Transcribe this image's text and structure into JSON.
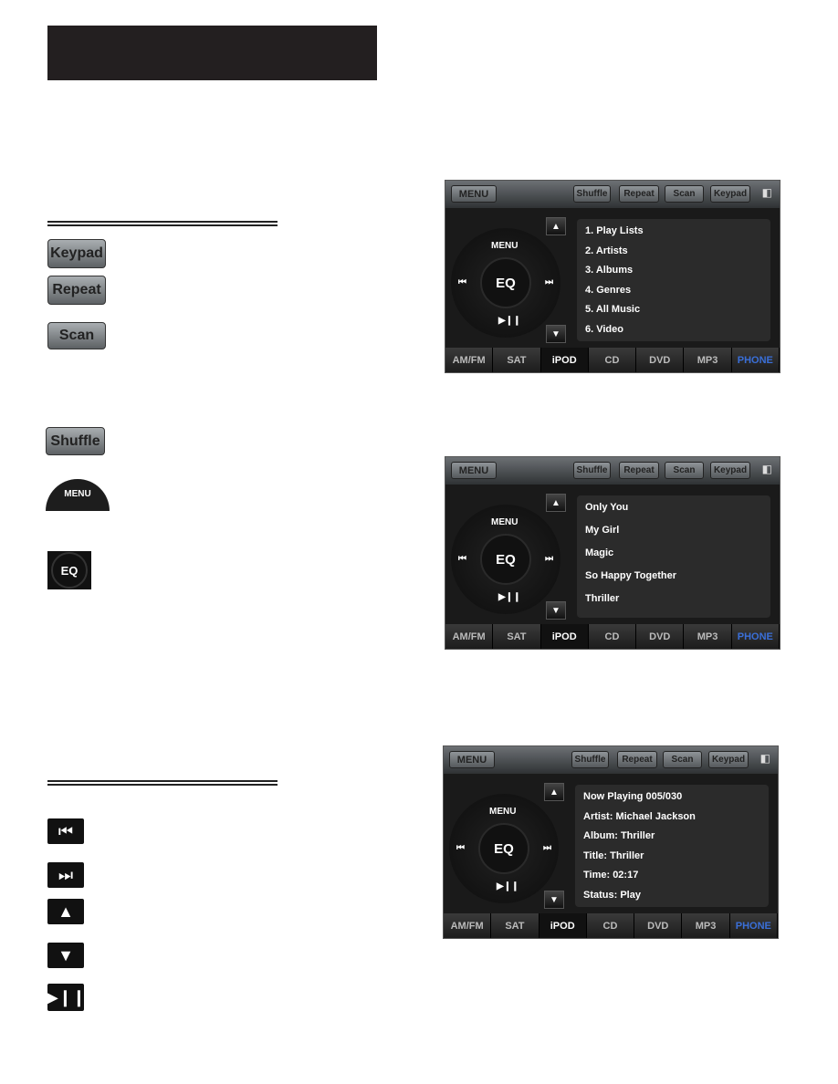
{
  "legend_buttons": {
    "keypad": "Keypad",
    "repeat": "Repeat",
    "scan": "Scan",
    "shuffle": "Shuffle",
    "menu": "MENU",
    "eq": "EQ"
  },
  "transport_icons": [
    "skip-back-icon",
    "skip-forward-icon",
    "arrow-up-icon",
    "arrow-down-icon",
    "play-pause-icon"
  ],
  "screens": [
    {
      "menu": "MENU",
      "buttons": [
        "Shuffle",
        "Repeat",
        "Scan",
        "Keypad"
      ],
      "dial_menu": "MENU",
      "eq": "EQ",
      "items": [
        "1. Play Lists",
        "2. Artists",
        "3. Albums",
        "4. Genres",
        "5. All Music",
        "6. Video"
      ],
      "tabs": [
        "AM/FM",
        "SAT",
        "iPOD",
        "CD",
        "DVD",
        "MP3",
        "PHONE"
      ],
      "active_tab": "iPOD"
    },
    {
      "menu": "MENU",
      "buttons": [
        "Shuffle",
        "Repeat",
        "Scan",
        "Keypad"
      ],
      "dial_menu": "MENU",
      "eq": "EQ",
      "items": [
        "Only You",
        "My Girl",
        "Magic",
        "So Happy Together",
        "Thriller"
      ],
      "tabs": [
        "AM/FM",
        "SAT",
        "iPOD",
        "CD",
        "DVD",
        "MP3",
        "PHONE"
      ],
      "active_tab": "iPOD"
    },
    {
      "menu": "MENU",
      "buttons": [
        "Shuffle",
        "Repeat",
        "Scan",
        "Keypad"
      ],
      "dial_menu": "MENU",
      "eq": "EQ",
      "items": [
        "Now Playing 005/030",
        "Artist: Michael Jackson",
        "Album: Thriller",
        "Title: Thriller",
        "Time: 02:17",
        "Status: Play"
      ],
      "tabs": [
        "AM/FM",
        "SAT",
        "iPOD",
        "CD",
        "DVD",
        "MP3",
        "PHONE"
      ],
      "active_tab": "iPOD"
    }
  ],
  "colors": {
    "phone_tab": "#3a6fd8",
    "header_bar": "#231f20"
  }
}
